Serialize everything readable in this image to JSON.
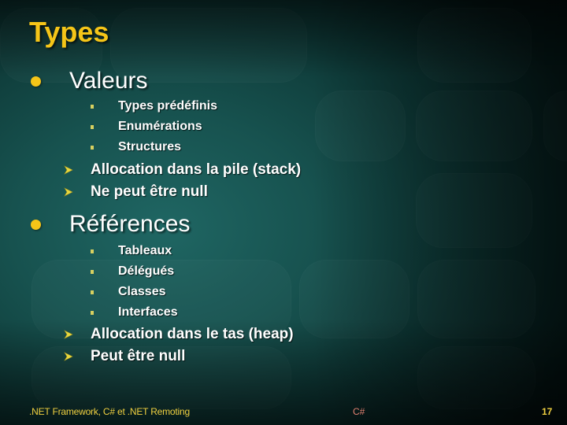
{
  "slide": {
    "title": "Types",
    "sections": [
      {
        "label": "Valeurs",
        "sub_items": [
          "Types prédéfinis",
          "Enumérations",
          "Structures"
        ],
        "properties": [
          "Allocation dans la pile (stack)",
          "Ne peut être null"
        ]
      },
      {
        "label": "Références",
        "sub_items": [
          "Tableaux",
          "Délégués",
          "Classes",
          "Interfaces"
        ],
        "properties": [
          "Allocation dans le tas (heap)",
          "Peut être null"
        ]
      }
    ]
  },
  "footer": {
    "left": ".NET Framework, C# et .NET Remoting",
    "center": "C#",
    "page_number": "17"
  },
  "colors": {
    "accent": "#f5c518",
    "text": "#ffffff",
    "footer_center": "#e08070"
  },
  "icons": {
    "level1_bullet": "yellow-dot-icon",
    "level2_bullet": "yellow-arrow-icon",
    "level3_bullet": "yellow-square-icon"
  }
}
